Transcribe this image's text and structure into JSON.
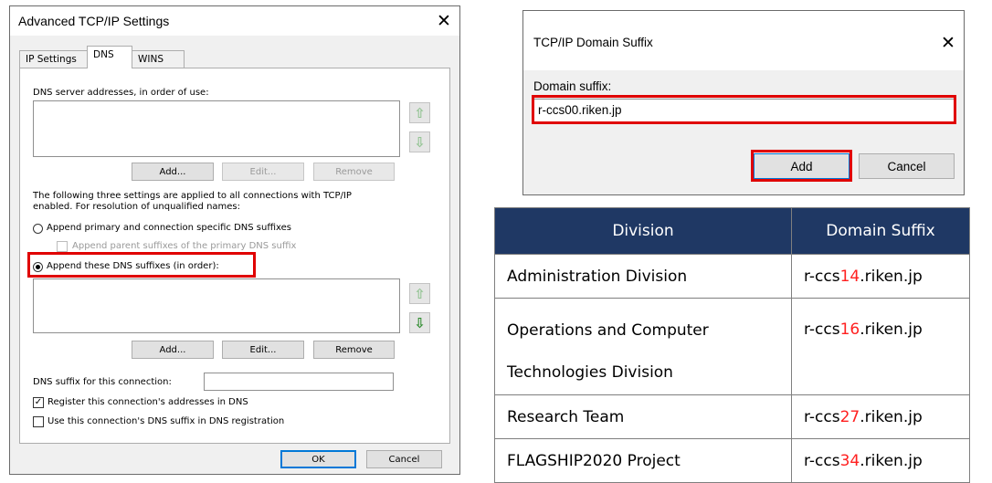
{
  "tcpip_dialog": {
    "title": "Advanced TCP/IP Settings",
    "close_glyph": "✕",
    "tabs": [
      "IP Settings",
      "DNS",
      "WINS"
    ],
    "dns_server_label": "DNS server addresses, in order of use:",
    "server_buttons": {
      "add": "Add...",
      "edit": "Edit...",
      "remove": "Remove"
    },
    "three_settings_text_1": "The following three settings are applied to all connections with TCP/IP",
    "three_settings_text_2": "enabled. For resolution of unqualified names:",
    "radio_primary": "Append primary and connection specific DNS suffixes",
    "check_parent": "Append parent suffixes of the primary DNS suffix",
    "radio_these": "Append these DNS suffixes (in order):",
    "suffix_buttons": {
      "add": "Add...",
      "edit": "Edit...",
      "remove": "Remove"
    },
    "dns_suffix_label": "DNS suffix for this connection:",
    "dns_suffix_value": "",
    "check_register": "Register this connection's addresses in DNS",
    "check_use_suffix": "Use this connection's DNS suffix in DNS registration",
    "ok": "OK",
    "cancel": "Cancel",
    "arrow_up_glyph": "⇧",
    "arrow_down_glyph": "⇩"
  },
  "domain_dialog": {
    "title": "TCP/IP Domain Suffix",
    "close_glyph": "✕",
    "label": "Domain suffix:",
    "value": "r-ccs00.riken.jp",
    "add": "Add",
    "cancel": "Cancel"
  },
  "table": {
    "headers": [
      "Division",
      "Domain Suffix"
    ],
    "rows": [
      {
        "division": "Administration Division",
        "prefix": "r-ccs",
        "num": "14",
        "suffix": ".riken.jp"
      },
      {
        "division_line1": "Operations and Computer",
        "division_line2": "Technologies Division",
        "prefix": "r-ccs",
        "num": "16",
        "suffix": ".riken.jp"
      },
      {
        "division": "Research Team",
        "prefix": "r-ccs",
        "num": "27",
        "suffix": ".riken.jp"
      },
      {
        "division": "FLAGSHIP2020 Project",
        "prefix": "r-ccs",
        "num": "34",
        "suffix": ".riken.jp"
      }
    ]
  },
  "colors": {
    "highlight": "#e00000",
    "table_header": "#1f3864",
    "number_red": "#ff2020",
    "arrow_green": "#2e8b2e"
  }
}
